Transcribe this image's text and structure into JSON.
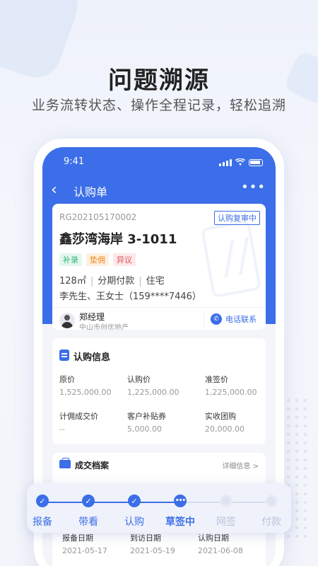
{
  "promo": {
    "headline": "问题溯源",
    "subline": "业务流转状态、操作全程记录，轻松追溯"
  },
  "status_bar": {
    "time": "9:41"
  },
  "nav": {
    "title": "认购单",
    "back_icon": "chevron-left-icon",
    "more_icon": "more-horizontal-icon"
  },
  "order": {
    "code": "RG202105170002",
    "status": "认购复审中",
    "project": "鑫莎湾海岸 3-1011",
    "tags": [
      {
        "label": "补录",
        "color": "#2cb574"
      },
      {
        "label": "垫佣",
        "color": "#ee8a1b"
      },
      {
        "label": "异议",
        "color": "#e5535a"
      }
    ],
    "area": "128㎡",
    "payment": "分期付款",
    "usage": "住宅",
    "sep": "|",
    "buyers": "李先生、王女士（159****7446）"
  },
  "agent": {
    "name": "郑经理",
    "company": "中山市创优地产",
    "call_label": "电话联系"
  },
  "subscription": {
    "title": "认购信息",
    "fields": [
      {
        "label": "原价",
        "value": "1,525,000.00"
      },
      {
        "label": "认购价",
        "value": "1,225,000.00"
      },
      {
        "label": "准签价",
        "value": "1,225,000.00"
      },
      {
        "label": "计佣成交价",
        "value": "--"
      },
      {
        "label": "客户补贴券",
        "value": "5,000.00"
      },
      {
        "label": "实收团购",
        "value": "20,000.00"
      }
    ]
  },
  "deal": {
    "title": "成交档案",
    "detail_link": "详细信息 >",
    "dates": [
      {
        "label": "报备日期",
        "value": "2021-05-17"
      },
      {
        "label": "到访日期",
        "value": "2021-05-19"
      },
      {
        "label": "认购日期",
        "value": "2021-06-08"
      }
    ]
  },
  "progress": {
    "steps": [
      {
        "label": "报备",
        "state": "done"
      },
      {
        "label": "带看",
        "state": "done"
      },
      {
        "label": "认购",
        "state": "done"
      },
      {
        "label": "草签中",
        "state": "current"
      },
      {
        "label": "网签",
        "state": "pending"
      },
      {
        "label": "付款",
        "state": "pending"
      }
    ],
    "done_glyph": "✓",
    "current_glyph": "•••"
  },
  "colors": {
    "primary": "#3b6ee8",
    "background": "#eef2fb"
  }
}
